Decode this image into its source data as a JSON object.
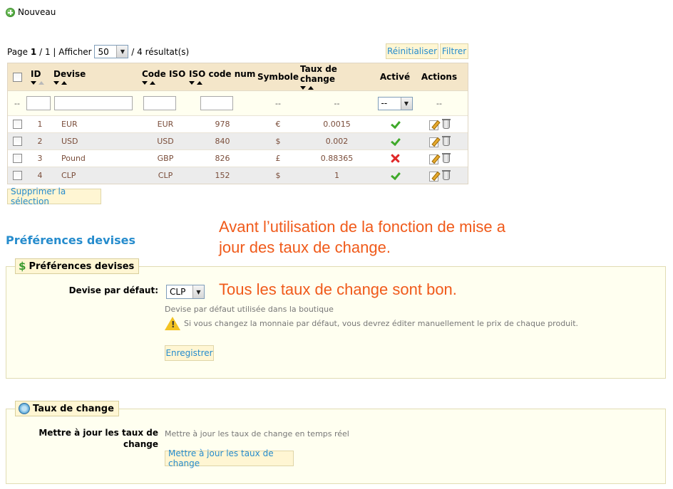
{
  "toolbar": {
    "new_label": "Nouveau"
  },
  "pager": {
    "page_word": "Page",
    "current_page": "1",
    "separator": "/",
    "total_pages": "1",
    "show_label": "| Afficher",
    "per_page": "50",
    "results": "/ 4 résultat(s)"
  },
  "buttons": {
    "reset": "Réinitialiser",
    "filter": "Filtrer",
    "delete_selection": "Supprimer la sélection",
    "save": "Enregistrer",
    "update_rates": "Mettre à jour les taux de change"
  },
  "table": {
    "headers": {
      "id": "ID",
      "devise": "Devise",
      "code_iso": "Code ISO",
      "iso_num": "ISO code num",
      "symbole": "Symbole",
      "taux": "Taux de change",
      "active": "Activé",
      "actions": "Actions"
    },
    "filter_placeholder": "--",
    "active_filter_value": "--",
    "rows": [
      {
        "id": "1",
        "devise": "EUR",
        "iso": "EUR",
        "num": "978",
        "sym": "€",
        "taux": "0.0015",
        "active": true
      },
      {
        "id": "2",
        "devise": "USD",
        "iso": "USD",
        "num": "840",
        "sym": "$",
        "taux": "0.002",
        "active": true
      },
      {
        "id": "3",
        "devise": "Pound",
        "iso": "GBP",
        "num": "826",
        "sym": "£",
        "taux": "0.88365",
        "active": false
      },
      {
        "id": "4",
        "devise": "CLP",
        "iso": "CLP",
        "num": "152",
        "sym": "$",
        "taux": "1",
        "active": true
      }
    ]
  },
  "preferences": {
    "section_title": "Préférences devises",
    "legend": "Préférences devises",
    "default_label": "Devise par défaut:",
    "default_value": "CLP",
    "default_help": "Devise par défaut utilisée dans la boutique",
    "warning": "Si vous changez la monnaie par défaut, vous devrez éditer manuellement le prix de chaque produit."
  },
  "rates": {
    "legend": "Taux de change",
    "label": "Mettre à jour les taux de change",
    "help": "Mettre à jour les taux de change en temps réel"
  },
  "annotations": {
    "line1": "Avant l’utilisation de la fonction de mise a jour des taux de change.",
    "line2": "Tous les taux de change sont bon."
  },
  "colors": {
    "accent": "#268ccd",
    "annotation": "#f05a1a",
    "header_bg": "#f4e6c9",
    "panel_bg": "#fffff0"
  }
}
